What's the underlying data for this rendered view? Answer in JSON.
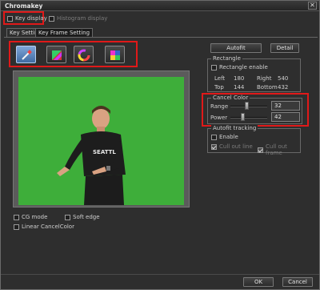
{
  "window": {
    "title": "Chromakey",
    "close_glyph": "✕"
  },
  "top_options": {
    "key_display": "Key display",
    "histogram_display": "Histogram display"
  },
  "tabs": [
    {
      "label": "Key Setting"
    },
    {
      "label": "Key Frame Setting"
    }
  ],
  "buttons": {
    "autofit": "Autofit",
    "detail": "Detail",
    "ok": "OK",
    "cancel": "Cancel"
  },
  "rectangle": {
    "legend": "Rectangle",
    "enable": "Rectangle enable",
    "left_label": "Left",
    "left_value": "180",
    "right_label": "Right",
    "right_value": "540",
    "top_label": "Top",
    "top_value": "144",
    "bottom_label": "Bottom",
    "bottom_value": "432"
  },
  "cancel_color": {
    "legend": "Cancel Color",
    "range_label": "Range",
    "range_value": "32",
    "power_label": "Power",
    "power_value": "42",
    "range_level": 0.45,
    "power_level": 0.32
  },
  "autofit_tracking": {
    "legend": "Autofit tracking",
    "enable": "Enable",
    "cull_out_line": "Cull out line",
    "cull_out_frame": "Cull out frame"
  },
  "bottom_options": {
    "cg_mode": "CG mode",
    "soft_edge": "Soft edge",
    "linear_cancel_color": "Linear CancelColor"
  },
  "preview": {
    "shirt_text": "SEATTLE"
  },
  "colors": {
    "accent": "#e01919",
    "green_screen": "#3eae3a",
    "selected_tool": "#5f8ac2"
  },
  "icons": [
    "eyedropper-icon",
    "color-wheel-icon",
    "hue-ring-icon",
    "color-square-icon"
  ]
}
